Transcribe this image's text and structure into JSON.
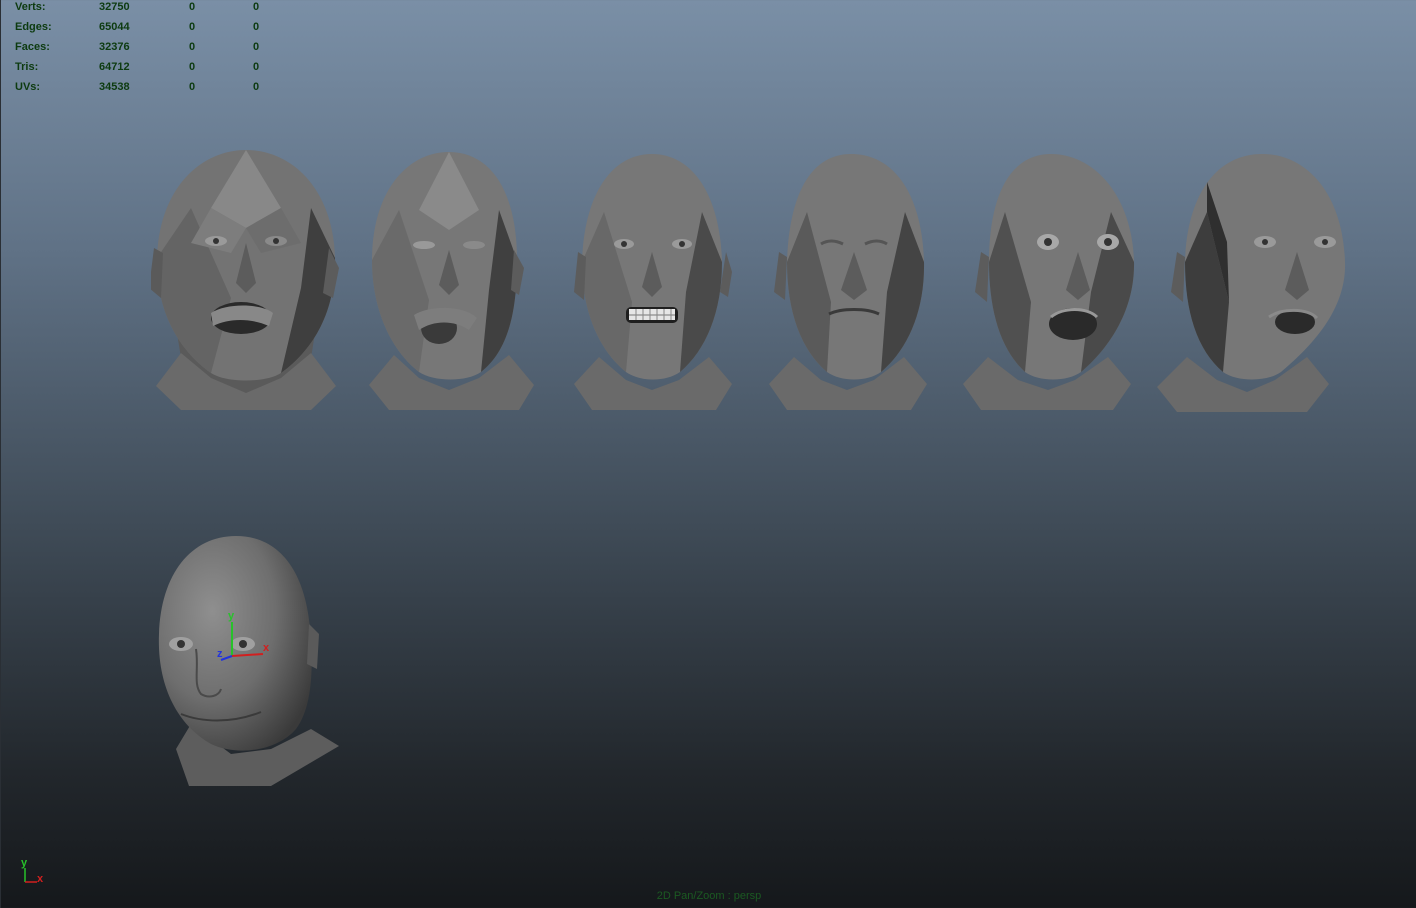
{
  "hud": {
    "rows": [
      {
        "label": "Verts:",
        "value": "32750",
        "selected": "0",
        "uv": "0"
      },
      {
        "label": "Edges:",
        "value": "65044",
        "selected": "0",
        "uv": "0"
      },
      {
        "label": "Faces:",
        "value": "32376",
        "selected": "0",
        "uv": "0"
      },
      {
        "label": "Tris:",
        "value": "64712",
        "selected": "0",
        "uv": "0"
      },
      {
        "label": "UVs:",
        "value": "34538",
        "selected": "0",
        "uv": "0"
      }
    ]
  },
  "manipulator": {
    "y_label": "y",
    "x_label": "x",
    "z_label": "z"
  },
  "view_axis": {
    "y_label": "y",
    "x_label": "x"
  },
  "status": {
    "camera_text": "2D Pan/Zoom : persp"
  },
  "colors": {
    "hud_text": "#0d3b10",
    "status_text": "#1b5a22",
    "mesh": "#6a6a6a",
    "x_axis": "#d21f1f",
    "y_axis": "#27c22a",
    "z_axis": "#2233dd"
  }
}
